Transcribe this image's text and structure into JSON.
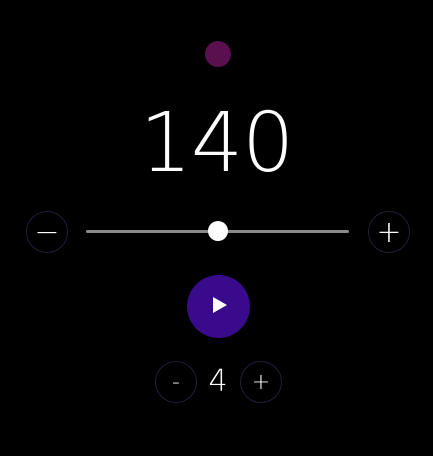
{
  "metronome": {
    "beat_indicator_color": "#5a0f4e",
    "tempo": "140",
    "tempo_decrease_label": "−",
    "tempo_increase_label": "+",
    "tempo_slider_level": 0.5,
    "play_icon": "play-icon",
    "play_button_color": "#3a0a8c",
    "beats_decrease_label": "-",
    "beats_per_measure": "4",
    "beats_increase_label": "+"
  }
}
